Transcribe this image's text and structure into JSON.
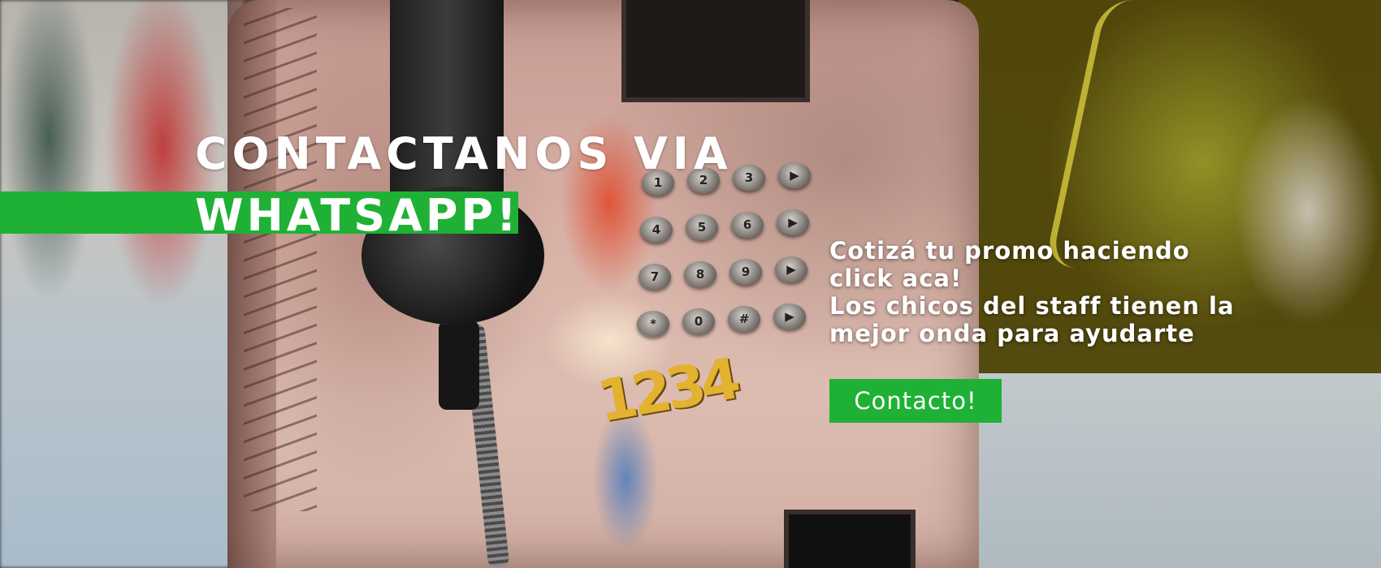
{
  "banner": {
    "heading_line1": "CONTACTANOS VIA",
    "heading_line2": "WHATSAPP!",
    "promo_line1": "Cotizá tu promo haciendo",
    "promo_line2": "click aca!",
    "promo_line3": "Los chicos del staff tienen la",
    "promo_line4": "mejor onda para ayudarte",
    "button_label": "Contacto!"
  },
  "background": {
    "graffiti_numbers": "1234",
    "keypad_keys": [
      "1",
      "2",
      "3",
      "▶",
      "4",
      "5",
      "6",
      "▶",
      "7",
      "8",
      "9",
      "▶",
      "*",
      "0",
      "#",
      "▶"
    ]
  },
  "colors": {
    "accent_green": "#1fb135",
    "text": "#ffffff"
  }
}
